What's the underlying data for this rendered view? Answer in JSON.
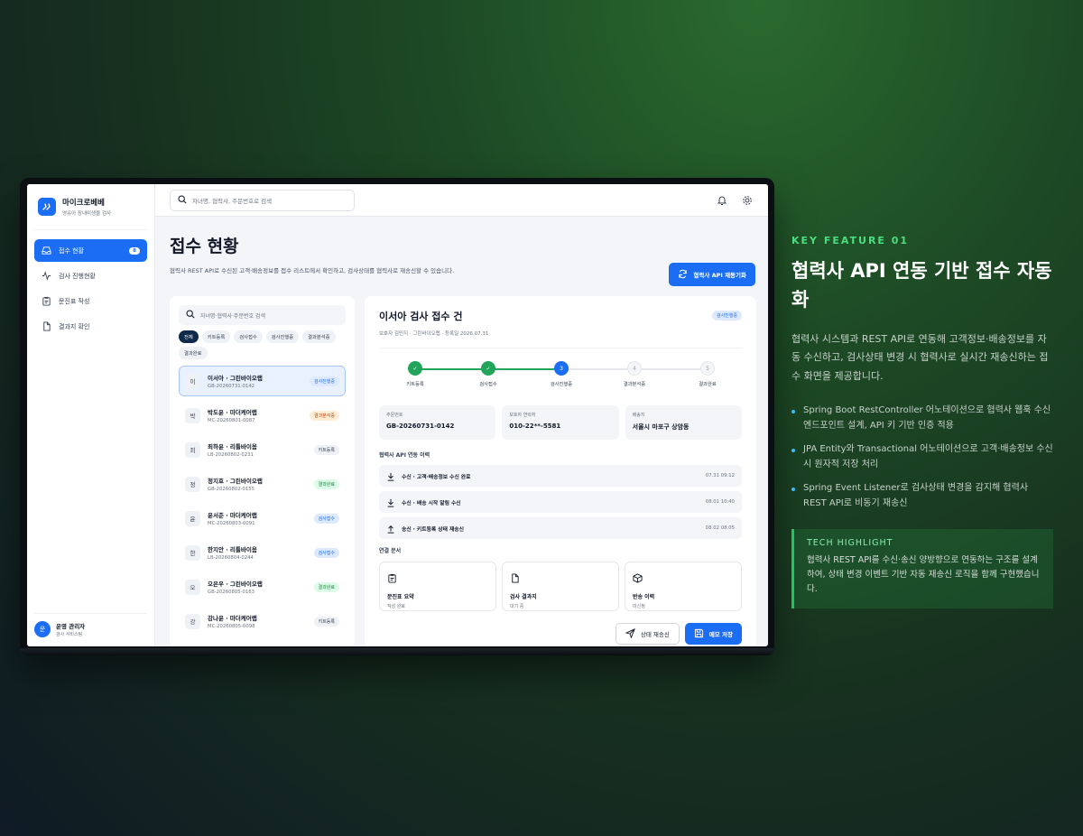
{
  "brand": {
    "name": "마이크로베베",
    "subtitle": "영유아 장내미생물 검사"
  },
  "sidebar": {
    "items": [
      {
        "label": "접수 현황",
        "badge": "8"
      },
      {
        "label": "검사 진행현황"
      },
      {
        "label": "문진표 작성"
      },
      {
        "label": "결과지 확인"
      }
    ],
    "user": {
      "avatar": "운",
      "name": "운영 관리자",
      "role": "검사 서비스팀"
    }
  },
  "topbar": {
    "search_placeholder": "자녀명, 협력사, 주문번호로 검색"
  },
  "page": {
    "title": "접수 현황",
    "description": "협력사 REST API로 수신된 고객·배송정보를 접수 리스트에서 확인하고, 검사상태를 협력사로 재송신할 수 있습니다.",
    "retry_button": "협력사 API 재동기화"
  },
  "list": {
    "search_placeholder": "자녀명·협력사·주문번호 검색",
    "filters": [
      "전체",
      "키트등록",
      "검사접수",
      "검사진행중",
      "결과분석중",
      "결과완료"
    ],
    "rows": [
      {
        "avatar": "이",
        "name": "이서아 · 그린바이오랩",
        "code": "GB-20260731-0142",
        "status": "검사진행중",
        "tone": "blue"
      },
      {
        "avatar": "박",
        "name": "박도윤 · 마더케어랩",
        "code": "MC-20260801-0087",
        "status": "결과분석중",
        "tone": "orange"
      },
      {
        "avatar": "최",
        "name": "최하윤 · 리틀바이옴",
        "code": "LB-20260802-0231",
        "status": "키트등록",
        "tone": "gray"
      },
      {
        "avatar": "정",
        "name": "정지호 · 그린바이오랩",
        "code": "GB-20260802-0155",
        "status": "결과완료",
        "tone": "green"
      },
      {
        "avatar": "윤",
        "name": "윤서준 · 마더케어랩",
        "code": "MC-20260803-0091",
        "status": "검사접수",
        "tone": "blue"
      },
      {
        "avatar": "한",
        "name": "한지안 · 리틀바이옴",
        "code": "LB-20260804-0244",
        "status": "검사접수",
        "tone": "blue"
      },
      {
        "avatar": "오",
        "name": "오은우 · 그린바이오랩",
        "code": "GB-20260805-0163",
        "status": "결과완료",
        "tone": "green"
      },
      {
        "avatar": "강",
        "name": "강나윤 · 마더케어랩",
        "code": "MC-20260805-0098",
        "status": "키트등록",
        "tone": "gray"
      }
    ]
  },
  "detail": {
    "title": "이서아 검사 접수 건",
    "meta": "보호자 김민지 · 그린바이오랩 · 등록일 2026.07.31",
    "status": "검사진행중",
    "steps": [
      {
        "label": "키트등록",
        "mark": "✓",
        "state": "done"
      },
      {
        "label": "검사접수",
        "mark": "✓",
        "state": "done"
      },
      {
        "label": "검사진행중",
        "mark": "3",
        "state": "current"
      },
      {
        "label": "결과분석중",
        "mark": "4",
        "state": "todo"
      },
      {
        "label": "결과완료",
        "mark": "5",
        "state": "todo"
      }
    ],
    "info": [
      {
        "label": "주문번호",
        "value": "GB-20260731-0142"
      },
      {
        "label": "보호자 연락처",
        "value": "010-22**-5581"
      },
      {
        "label": "배송지",
        "value": "서울시 마포구 상암동"
      }
    ],
    "history_title": "협력사 API 연동 이력",
    "history": [
      {
        "direction": "수신",
        "text": "수신 · 고객·배송정보 수신 완료",
        "time": "07.31 09:12"
      },
      {
        "direction": "수신",
        "text": "수신 · 배송 시작 알림 수신",
        "time": "08.01 10:40"
      },
      {
        "direction": "송신",
        "text": "송신 · 키트등록 상태 재송신",
        "time": "08.02 08:05"
      }
    ],
    "docs_title": "연결 문서",
    "docs": [
      {
        "icon": "clipboard-icon",
        "title": "문진표 요약",
        "sub": "작성 완료"
      },
      {
        "icon": "document-icon",
        "title": "검사 결과지",
        "sub": "대기 중"
      },
      {
        "icon": "box-icon",
        "title": "반송 이력",
        "sub": "미신청"
      }
    ],
    "resend_button": "상태 재송신",
    "save_button": "메모 저장"
  },
  "feature": {
    "kicker": "KEY FEATURE 01",
    "title": "협력사 API 연동 기반 접수 자동화",
    "description": "협력사 시스템과 REST API로 연동해 고객정보·배송정보를 자동 수신하고, 검사상태 변경 시 협력사로 실시간 재송신하는 접수 화면을 제공합니다.",
    "bullets": [
      "Spring Boot RestController 어노테이션으로 협력사 웹훅 수신 엔드포인트 설계, API 키 기반 인증 적용",
      "JPA Entity와 Transactional 어노테이션으로 고객·배송정보 수신 시 원자적 저장 처리",
      "Spring Event Listener로 검사상태 변경을 감지해 협력사 REST API로 비동기 재송신"
    ],
    "highlight_title": "TECH HIGHLIGHT",
    "highlight_text": "협력사 REST API를 수신·송신 양방향으로 연동하는 구조를 설계하여, 상태 변경 이벤트 기반 자동 재송신 로직을 함께 구현했습니다."
  },
  "colors": {
    "accent": "#1b6ef3",
    "done": "#22a55a",
    "feature_green": "#4ade80"
  }
}
